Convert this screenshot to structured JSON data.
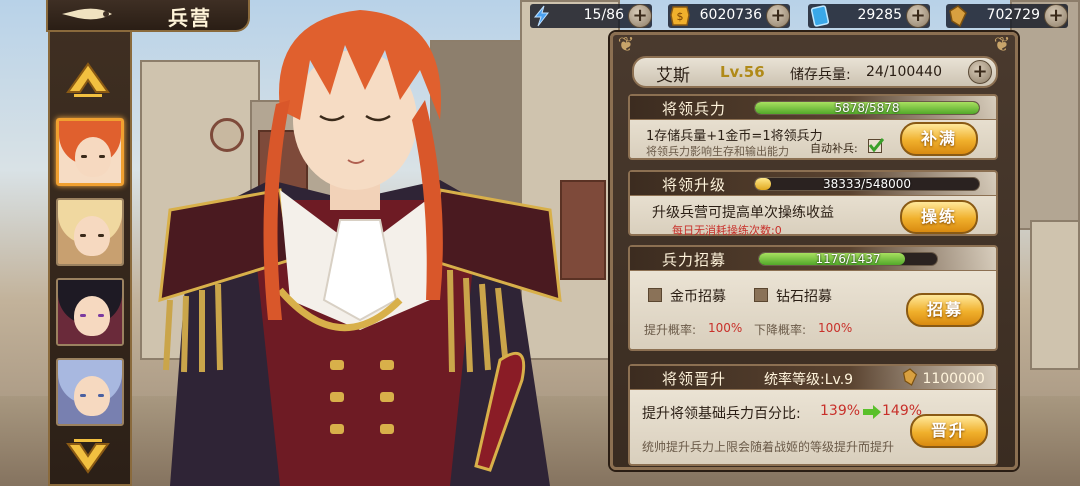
{
  "header": {
    "title": "兵营"
  },
  "resources": [
    {
      "name": "stamina",
      "icon": "lightning-icon",
      "value": "15/86"
    },
    {
      "name": "gold",
      "icon": "gold-coin-icon",
      "value": "6020736"
    },
    {
      "name": "diamond",
      "icon": "card-icon",
      "value": "29285"
    },
    {
      "name": "medal",
      "icon": "medal-icon",
      "value": "702729"
    }
  ],
  "hero": {
    "name": "艾斯",
    "level": "Lv.56",
    "stock_label": "储存兵量:",
    "stock_value": "24/100440"
  },
  "power": {
    "title": "将领兵力",
    "progress": "5878/5878",
    "progress_ratio": 1.0,
    "line1": "1存储兵量+1金币=1将领兵力",
    "line2": "将领兵力影响生存和输出能力",
    "auto_label": "自动补兵:",
    "button": "补满"
  },
  "upgrade": {
    "title": "将领升级",
    "progress": "38333/548000",
    "progress_ratio": 0.07,
    "line1": "升级兵营可提高单次操练收益",
    "line2": "每日无消耗操练次数:0",
    "button": "操练"
  },
  "recruit": {
    "title": "兵力招募",
    "progress": "1176/1437",
    "progress_ratio": 0.818,
    "opt_gold": "金币招募",
    "opt_diamond": "钻石招募",
    "up_label": "提升概率:",
    "up_value": "100%",
    "down_label": "下降概率:",
    "down_value": "100%",
    "button": "招募"
  },
  "promote": {
    "title": "将领晋升",
    "rank": "统率等级:Lv.9",
    "cost": "1100000",
    "line1_label": "提升将领基础兵力百分比:",
    "from": "139%",
    "to": "149%",
    "line2": "统帅提升兵力上限会随着战姬的等级提升而提升",
    "button": "晋升"
  },
  "colors": {
    "accent": "#f0b02c",
    "green": "#52a82a",
    "red": "#c8302a",
    "panel": "#3a2c21"
  }
}
